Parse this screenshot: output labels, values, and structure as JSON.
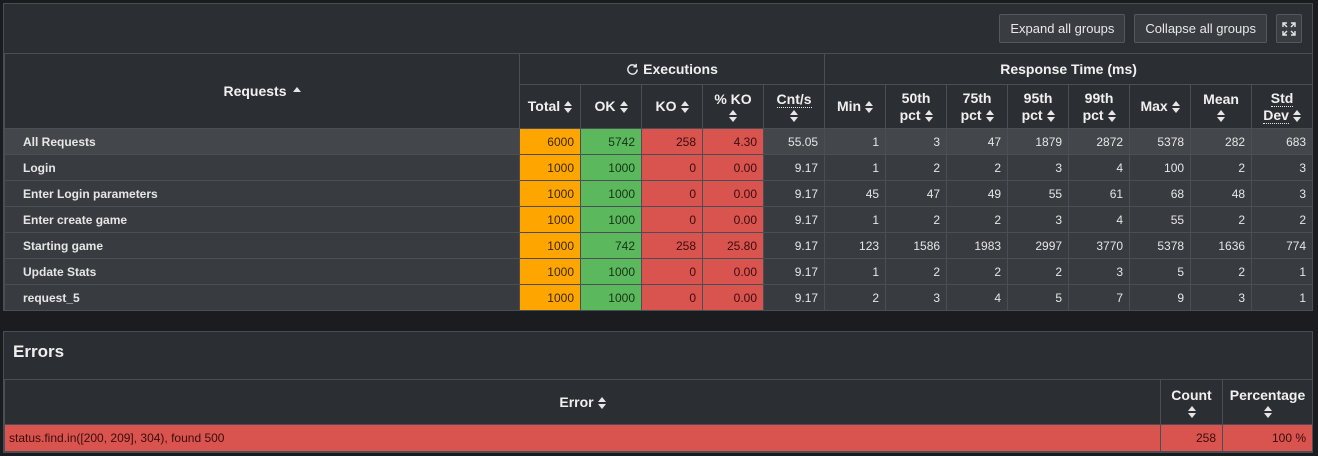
{
  "toolbar": {
    "expand_label": "Expand all groups",
    "collapse_label": "Collapse all groups",
    "fullscreen_icon": "expand-arrows-icon"
  },
  "stats": {
    "requests_header": "Requests",
    "executions_header": "Executions",
    "response_time_header": "Response Time (ms)",
    "columns": {
      "total": "Total",
      "ok": "OK",
      "ko": "KO",
      "pko": "% KO",
      "cnt": "Cnt/s",
      "min": "Min",
      "p50a": "50th",
      "p50b": "pct",
      "p75a": "75th",
      "p75b": "pct",
      "p95a": "95th",
      "p95b": "pct",
      "p99a": "99th",
      "p99b": "pct",
      "max": "Max",
      "mean": "Mean",
      "stda": "Std",
      "stdb": "Dev"
    },
    "rows": [
      {
        "name": "All Requests",
        "total": "6000",
        "ok": "5742",
        "ko": "258",
        "pko": "4.30",
        "cnt": "55.05",
        "min": "1",
        "p50": "3",
        "p75": "47",
        "p95": "1879",
        "p99": "2872",
        "max": "5378",
        "mean": "282",
        "std": "683"
      },
      {
        "name": "Login",
        "total": "1000",
        "ok": "1000",
        "ko": "0",
        "pko": "0.00",
        "cnt": "9.17",
        "min": "1",
        "p50": "2",
        "p75": "2",
        "p95": "3",
        "p99": "4",
        "max": "100",
        "mean": "2",
        "std": "3"
      },
      {
        "name": "Enter Login parameters",
        "total": "1000",
        "ok": "1000",
        "ko": "0",
        "pko": "0.00",
        "cnt": "9.17",
        "min": "45",
        "p50": "47",
        "p75": "49",
        "p95": "55",
        "p99": "61",
        "max": "68",
        "mean": "48",
        "std": "3"
      },
      {
        "name": "Enter create game",
        "total": "1000",
        "ok": "1000",
        "ko": "0",
        "pko": "0.00",
        "cnt": "9.17",
        "min": "1",
        "p50": "2",
        "p75": "2",
        "p95": "3",
        "p99": "4",
        "max": "55",
        "mean": "2",
        "std": "2"
      },
      {
        "name": "Starting game",
        "total": "1000",
        "ok": "742",
        "ko": "258",
        "pko": "25.80",
        "cnt": "9.17",
        "min": "123",
        "p50": "1586",
        "p75": "1983",
        "p95": "2997",
        "p99": "3770",
        "max": "5378",
        "mean": "1636",
        "std": "774"
      },
      {
        "name": "Update Stats",
        "total": "1000",
        "ok": "1000",
        "ko": "0",
        "pko": "0.00",
        "cnt": "9.17",
        "min": "1",
        "p50": "2",
        "p75": "2",
        "p95": "2",
        "p99": "3",
        "max": "5",
        "mean": "2",
        "std": "1"
      },
      {
        "name": "request_5",
        "total": "1000",
        "ok": "1000",
        "ko": "0",
        "pko": "0.00",
        "cnt": "9.17",
        "min": "2",
        "p50": "3",
        "p75": "4",
        "p95": "5",
        "p99": "7",
        "max": "9",
        "mean": "3",
        "std": "1"
      }
    ]
  },
  "errors": {
    "title": "Errors",
    "col_error": "Error",
    "col_count": "Count",
    "col_percentage": "Percentage",
    "rows": [
      {
        "error": "status.find.in([200, 209], 304), found 500",
        "count": "258",
        "percentage": "100 %"
      }
    ]
  },
  "colors": {
    "total": "#ffa500",
    "ok": "#5cb85c",
    "ko": "#d9534f",
    "panel": "#2b2f33"
  }
}
